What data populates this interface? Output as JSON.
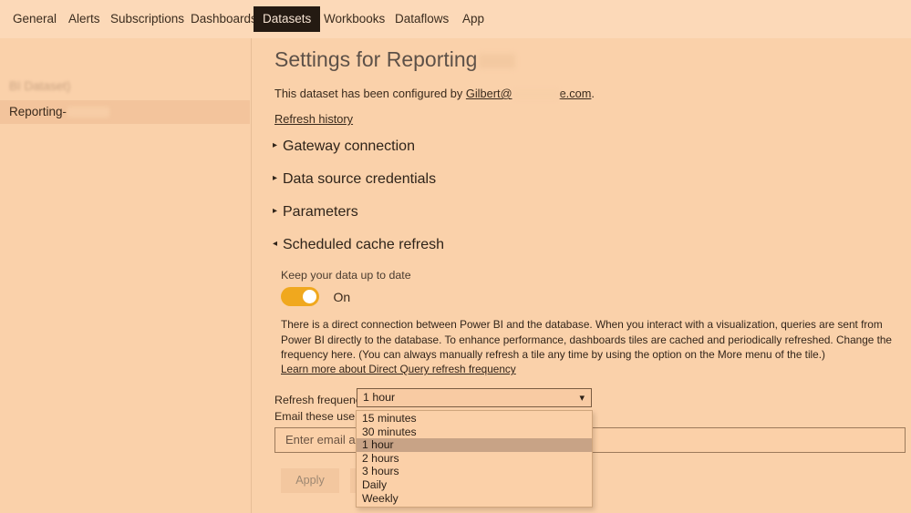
{
  "tabs": [
    {
      "label": "General",
      "active": false
    },
    {
      "label": "Alerts",
      "active": false
    },
    {
      "label": "Subscriptions",
      "active": false
    },
    {
      "label": "Dashboards",
      "active": false
    },
    {
      "label": "Datasets",
      "active": true
    },
    {
      "label": "Workbooks",
      "active": false
    },
    {
      "label": "Dataflows",
      "active": false
    },
    {
      "label": "App",
      "active": false
    }
  ],
  "sidebar": {
    "group_label": "BI Dataset)",
    "items": [
      {
        "label": "Reporting-",
        "selected": true
      }
    ]
  },
  "main": {
    "title_prefix": "Settings for Reporting",
    "configured_prefix": "This dataset has been configured by",
    "configured_email_start": "Gilbert@",
    "configured_email_end": "e.com",
    "configured_suffix": ".",
    "refresh_history_link": "Refresh history",
    "sections": [
      {
        "name": "gateway",
        "label": "Gateway connection",
        "chevron": "▸",
        "expanded": false
      },
      {
        "name": "datasrc",
        "label": "Data source credentials",
        "chevron": "▸",
        "expanded": false
      },
      {
        "name": "params",
        "label": "Parameters",
        "chevron": "▸",
        "expanded": false
      },
      {
        "name": "schedule",
        "label": "Scheduled cache refresh",
        "chevron": "◂",
        "expanded": true
      }
    ],
    "schedule": {
      "keep_up_to_date_label": "Keep your data up to date",
      "toggle_state": "On",
      "description": "There is a direct connection between Power BI and the database. When you interact with a visualization, queries are sent from Power BI directly to the database. To enhance performance, dashboards tiles are cached and periodically refreshed. Change the frequency here. (You can always manually refresh a tile any time by using the option on the More menu of the tile.)",
      "learn_more_link": "Learn more about Direct Query refresh frequency",
      "refresh_frequency_label": "Refresh frequency",
      "refresh_frequency_value": "1 hour",
      "refresh_frequency_options": [
        "15 minutes",
        "30 minutes",
        "1 hour",
        "2 hours",
        "3 hours",
        "Daily",
        "Weekly"
      ],
      "email_users_label": "Email these users w",
      "email_placeholder": "Enter email add",
      "apply_label": "Apply",
      "discard_label": ""
    }
  },
  "colors": {
    "page_background": "#fad1aa",
    "tabbar_background": "#fcd9b8",
    "active_tab_background": "#241a12",
    "toggle_on": "#f0a81e",
    "option_selected": "#c8a386"
  }
}
